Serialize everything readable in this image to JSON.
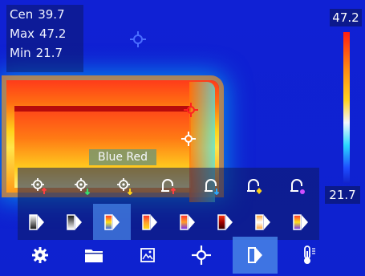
{
  "readout": {
    "cen_label": "Cen",
    "cen_value": "39.7",
    "max_label": "Max",
    "max_value": "47.2",
    "min_label": "Min",
    "min_value": "21.7"
  },
  "scale": {
    "max": "47.2",
    "min": "21.7"
  },
  "palette_label": "Blue Red",
  "alarm_icons": [
    "spot-alarm-red-icon",
    "spot-alarm-green-icon",
    "spot-alarm-yellow-icon",
    "bell-alarm-red-icon",
    "bell-alarm-blue-icon",
    "bell-alarm-yellow-icon",
    "bell-alarm-purple-icon"
  ],
  "palette_icons": [
    {
      "name": "palette-white-hot-icon",
      "selected": false
    },
    {
      "name": "palette-black-hot-icon",
      "selected": false
    },
    {
      "name": "palette-rainbow-icon",
      "selected": true
    },
    {
      "name": "palette-blue-red-icon",
      "selected": false
    },
    {
      "name": "palette-ironbow-icon",
      "selected": false
    },
    {
      "name": "palette-red-hot-icon",
      "selected": false
    },
    {
      "name": "palette-fusion-icon",
      "selected": false
    },
    {
      "name": "palette-rainbow-hc-icon",
      "selected": false
    }
  ],
  "toolbar": [
    {
      "name": "settings-icon",
      "selected": false
    },
    {
      "name": "folder-icon",
      "selected": false
    },
    {
      "name": "image-icon",
      "selected": false
    },
    {
      "name": "crosshair-icon",
      "selected": false
    },
    {
      "name": "palette-icon",
      "selected": true
    },
    {
      "name": "thermometer-icon",
      "selected": false
    }
  ],
  "colors": {
    "accent": "#4682e6",
    "alarm_red": "#ff4040",
    "alarm_green": "#38e070",
    "alarm_yellow": "#ffd21a",
    "alarm_blue": "#2aa8ff",
    "alarm_purple": "#d050ff",
    "crosshair_blue": "#4a6dff",
    "crosshair_white": "#ffffff"
  }
}
